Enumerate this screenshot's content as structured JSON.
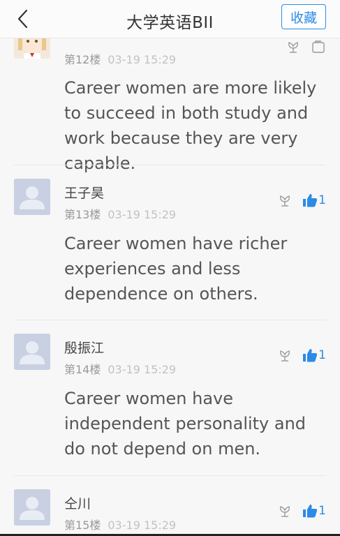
{
  "header": {
    "title": "大学英语BII",
    "favorite_label": "收藏"
  },
  "posts": [
    {
      "author": "",
      "floor": "第12楼",
      "time": "03-19 15:29",
      "content": "Career women are more likely to succeed in both study and work because they are very capable.",
      "likes": ""
    },
    {
      "author": "王子昊",
      "floor": "第13楼",
      "time": "03-19 15:29",
      "content": "Career women have richer experiences and less dependence on others.",
      "likes": "1"
    },
    {
      "author": "殷振江",
      "floor": "第14楼",
      "time": "03-19 15:29",
      "content": "Career women have independent personality  and do not depend on men.",
      "likes": "1"
    },
    {
      "author": "仝川",
      "floor": "第15楼",
      "time": "03-19 15:29",
      "content": "",
      "likes": "1"
    }
  ],
  "colors": {
    "accent": "#2b8be6",
    "avatar_placeholder": "#c8d0e2"
  }
}
